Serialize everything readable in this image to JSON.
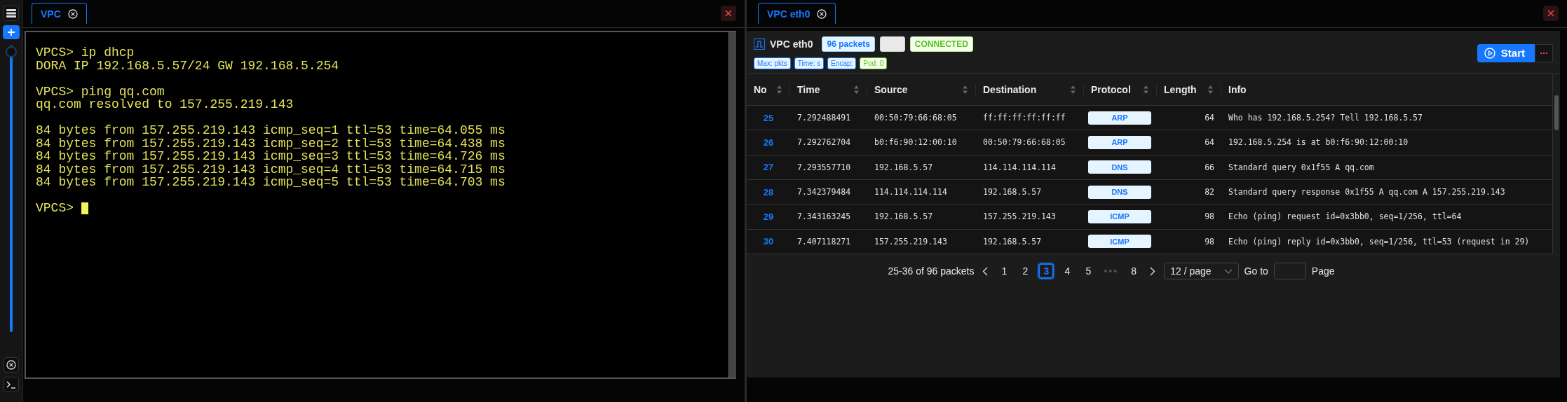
{
  "sidebar": {
    "slider": {
      "level": 1
    }
  },
  "terminal": {
    "tab": {
      "label": "VPC",
      "selected": true
    },
    "blocks": [
      [
        "VPCS> ip dhcp",
        "DORA IP 192.168.5.57/24 GW 192.168.5.254"
      ],
      [
        "VPCS> ping qq.com",
        "qq.com resolved to 157.255.219.143"
      ],
      [
        "84 bytes from 157.255.219.143 icmp_seq=1 ttl=53 time=64.055 ms",
        "84 bytes from 157.255.219.143 icmp_seq=2 ttl=53 time=64.438 ms",
        "84 bytes from 157.255.219.143 icmp_seq=3 ttl=53 time=64.726 ms",
        "84 bytes from 157.255.219.143 icmp_seq=4 ttl=53 time=64.715 ms",
        "84 bytes from 157.255.219.143 icmp_seq=5 ttl=53 time=64.703 ms"
      ],
      [
        "VPCS>"
      ]
    ],
    "cursor": true
  },
  "capture": {
    "tab": {
      "label": "VPC eth0",
      "selected": true
    },
    "title": "VPC eth0",
    "badges": [
      {
        "kind": "info",
        "text": "96 packets"
      },
      {
        "kind": "blank"
      },
      {
        "kind": "success",
        "text": "CONNECTED"
      }
    ],
    "filters": [
      {
        "kind": "info",
        "text": "Max: pkts"
      },
      {
        "kind": "info",
        "text": "Time: s"
      },
      {
        "kind": "info",
        "text": "Encap:"
      },
      {
        "kind": "success",
        "text": "Pod: 0"
      }
    ],
    "start_button": "Start",
    "columns": [
      "No",
      "Time",
      "Source",
      "Destination",
      "Protocol",
      "Length",
      "Info"
    ],
    "rows": [
      {
        "no": "25",
        "time": "7.292488491",
        "source": "00:50:79:66:68:05",
        "destination": "ff:ff:ff:ff:ff:ff",
        "protocol": "ARP",
        "length": "64",
        "info": "Who has 192.168.5.254? Tell 192.168.5.57"
      },
      {
        "no": "26",
        "time": "7.292762704",
        "source": "b0:f6:90:12:00:10",
        "destination": "00:50:79:66:68:05",
        "protocol": "ARP",
        "length": "64",
        "info": "192.168.5.254 is at b0:f6:90:12:00:10"
      },
      {
        "no": "27",
        "time": "7.293557710",
        "source": "192.168.5.57",
        "destination": "114.114.114.114",
        "protocol": "DNS",
        "length": "66",
        "info": "Standard query 0x1f55 A qq.com"
      },
      {
        "no": "28",
        "time": "7.342379484",
        "source": "114.114.114.114",
        "destination": "192.168.5.57",
        "protocol": "DNS",
        "length": "82",
        "info": "Standard query response 0x1f55 A qq.com A 157.255.219.143"
      },
      {
        "no": "29",
        "time": "7.343163245",
        "source": "192.168.5.57",
        "destination": "157.255.219.143",
        "protocol": "ICMP",
        "length": "98",
        "info": "Echo (ping) request id=0x3bb0, seq=1/256, ttl=64"
      },
      {
        "no": "30",
        "time": "7.407118271",
        "source": "157.255.219.143",
        "destination": "192.168.5.57",
        "protocol": "ICMP",
        "length": "98",
        "info": "Echo (ping) reply id=0x3bb0, seq=1/256, ttl=53 (request in 29)"
      }
    ],
    "pagination": {
      "summary": "25-36 of 96 packets",
      "pages": [
        {
          "kind": "page",
          "label": "1",
          "selected": false
        },
        {
          "kind": "page",
          "label": "2",
          "selected": false
        },
        {
          "kind": "page",
          "label": "3",
          "selected": true
        },
        {
          "kind": "page",
          "label": "4",
          "selected": false
        },
        {
          "kind": "page",
          "label": "5",
          "selected": false
        },
        {
          "kind": "ellipsis",
          "label": "•••"
        },
        {
          "kind": "page",
          "label": "8",
          "selected": false
        }
      ],
      "page_size": "12 / page",
      "goto_label": "Go to",
      "page_label": "Page"
    }
  }
}
